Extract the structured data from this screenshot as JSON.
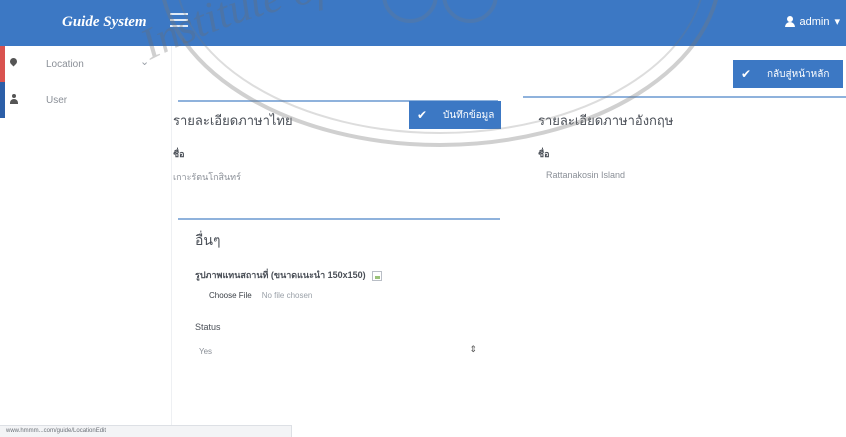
{
  "app": {
    "brand": "Guide System",
    "user_label": "admin",
    "caret": "▾"
  },
  "sidebar": {
    "items": [
      {
        "label": "Location",
        "chevron": "⌄",
        "accent": "#d9534f"
      },
      {
        "label": "User",
        "accent": "#2c5fa8"
      }
    ]
  },
  "toolbar": {
    "back_label": "กลับสู่หน้าหลัก",
    "save_label": "บันทึกข้อมูล",
    "check_glyph": "✔"
  },
  "thai_section": {
    "title": "รายละเอียดภาษาไทย",
    "name_label": "ชื่อ",
    "name_value": "เกาะรัตนโกสินทร์"
  },
  "english_section": {
    "title": "รายละเอียดภาษาอังกฤษ",
    "name_label": "ชื่อ",
    "name_value": "Rattanakosin Island"
  },
  "other_section": {
    "title": "อื่นๆ",
    "image_label": "รูปภาพแทนสถานที่ (ขนาดแนะนำ 150x150)",
    "file_button": "Choose File",
    "file_status": "No file chosen",
    "status_label": "Status",
    "status_value": "Yes",
    "select_arrows": "⇕"
  },
  "watermark": {
    "text": "Institute of Techno"
  },
  "statusbar": {
    "url": "www.hmmm...com/guide/LocationEdit"
  },
  "colors": {
    "navbar": "#3c78c4",
    "accent_line": "#8fb2dc",
    "location_marker": "#d9534f",
    "user_marker": "#2c5fa8"
  }
}
